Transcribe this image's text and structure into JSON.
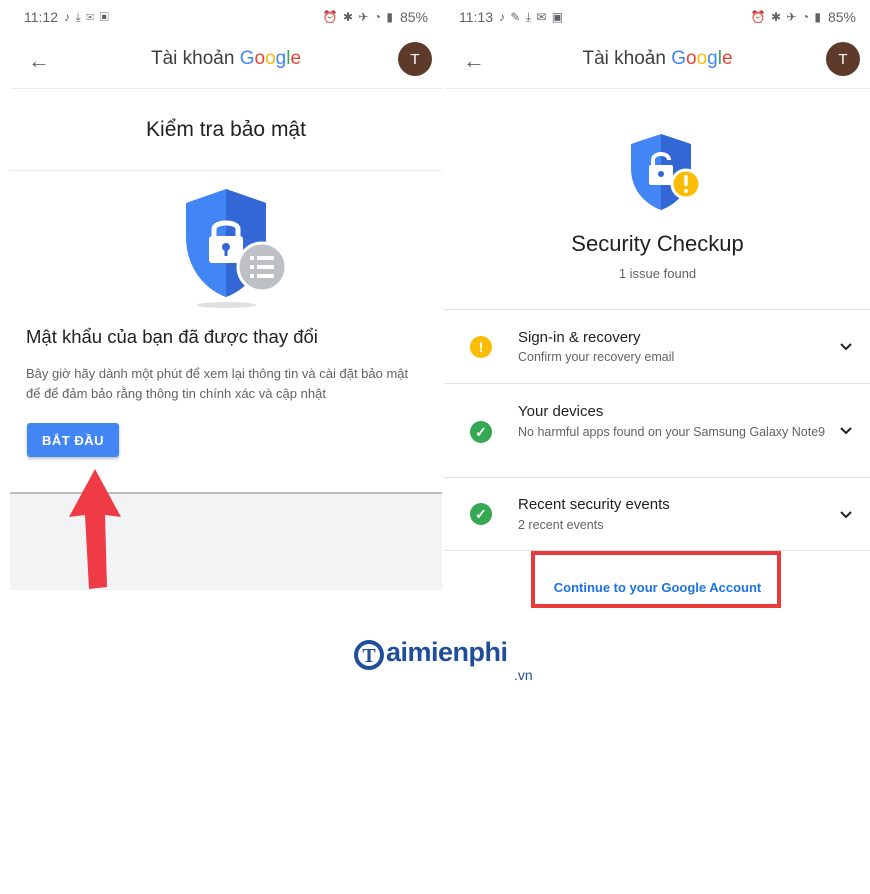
{
  "left": {
    "status": {
      "time": "11:12",
      "icons": "♪ ⤓ ✉ ▣",
      "right_icons": "⏰ ✱ ✈ ◔ ▮",
      "battery": "85%"
    },
    "appbar": {
      "title_prefix": "Tài khoản ",
      "brand": [
        "G",
        "o",
        "o",
        "g",
        "l",
        "e"
      ],
      "avatar": "T"
    },
    "heading": "Kiểm tra bảo mật",
    "message_title": "Mật khẩu của bạn đã được thay đổi",
    "message_body": "Bây giờ hãy dành một phút để xem lại thông tin và cài đặt bảo mật để để đảm bảo rằng thông tin chính xác và cập nhật",
    "start_button": "BẮT ĐẦU"
  },
  "right": {
    "status": {
      "time": "11:13",
      "icons": "♪ ✎ ⤓ ✉ ▣",
      "right_icons": "⏰ ✱ ✈ ◔ ▮",
      "battery": "85%"
    },
    "appbar": {
      "title_prefix": "Tài khoản ",
      "brand": [
        "G",
        "o",
        "o",
        "g",
        "l",
        "e"
      ],
      "avatar": "T"
    },
    "title": "Security Checkup",
    "subtitle": "1 issue found",
    "rows": [
      {
        "title": "Sign-in & recovery",
        "desc": "Confirm your recovery email",
        "status": "warning"
      },
      {
        "title": "Your devices",
        "desc": "No harmful apps found on your Samsung Galaxy Note9",
        "status": "ok"
      },
      {
        "title": "Recent security events",
        "desc": "2 recent events",
        "status": "ok"
      }
    ],
    "continue_link": "Continue to your Google Account"
  },
  "watermark": {
    "main": "aimienphi",
    "tld": ".vn",
    "initial": "T"
  },
  "colors": {
    "google_blue": "#4285f4",
    "google_red": "#ea4335",
    "google_yellow": "#fbbc05",
    "google_green": "#34a853",
    "link": "#1a73e8",
    "annotation_red": "#ea3b3b"
  }
}
